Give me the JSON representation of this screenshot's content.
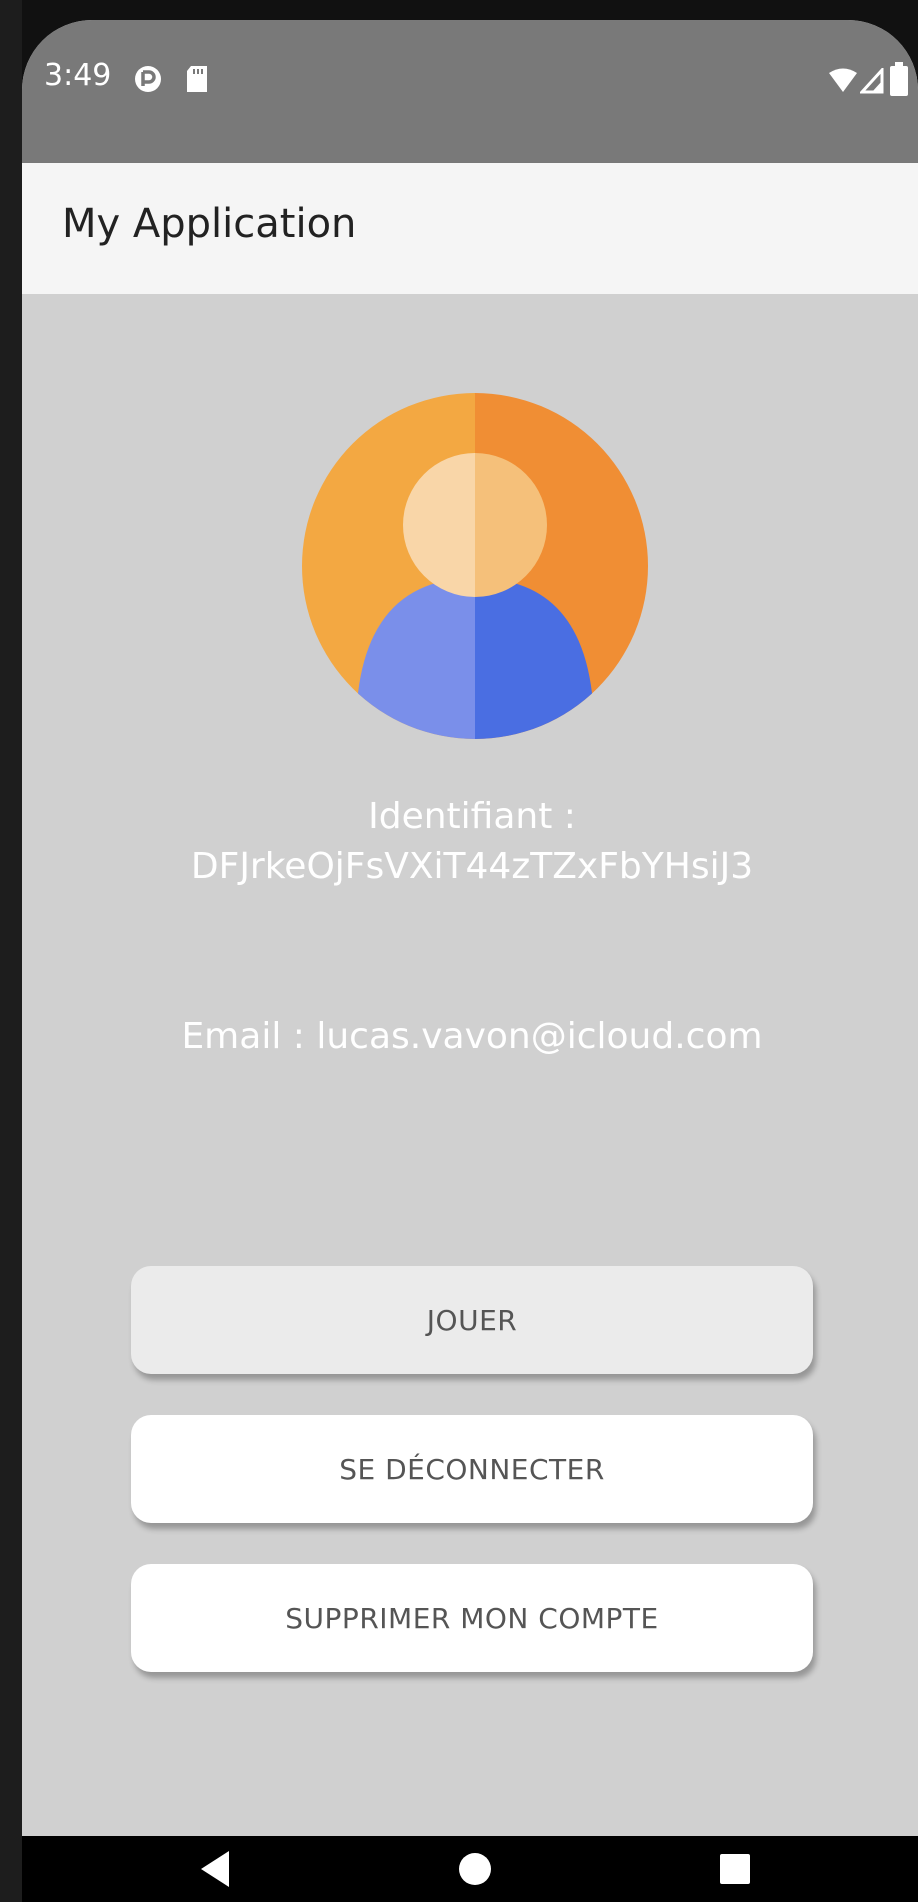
{
  "status_bar": {
    "time": "3:49",
    "icons": [
      "sync-icon",
      "sd-card-icon",
      "wifi-icon",
      "signal-icon",
      "battery-icon"
    ]
  },
  "app_bar": {
    "title": "My Application"
  },
  "profile": {
    "avatar_icon": "user-avatar-icon",
    "identifier_label": "Identifiant :",
    "identifier_value": "DFJrkeOjFsVXiT44zTZxFbYHsiJ3",
    "email_label": "Email :",
    "email_value": "lucas.vavon@icloud.com"
  },
  "buttons": {
    "play": "JOUER",
    "logout": "SE DÉCONNECTER",
    "delete_account": "SUPPRIMER MON COMPTE"
  },
  "navigation": {
    "icons": [
      "back-icon",
      "home-icon",
      "recents-icon"
    ]
  },
  "colors": {
    "status_bar": "#797979",
    "app_bar": "#f5f5f5",
    "background": "#d0d0d0",
    "avatar_orange_light": "#f3a842",
    "avatar_orange_dark": "#f08e34",
    "avatar_blue_light": "#7a8fea",
    "avatar_blue_dark": "#4a6ee2"
  }
}
